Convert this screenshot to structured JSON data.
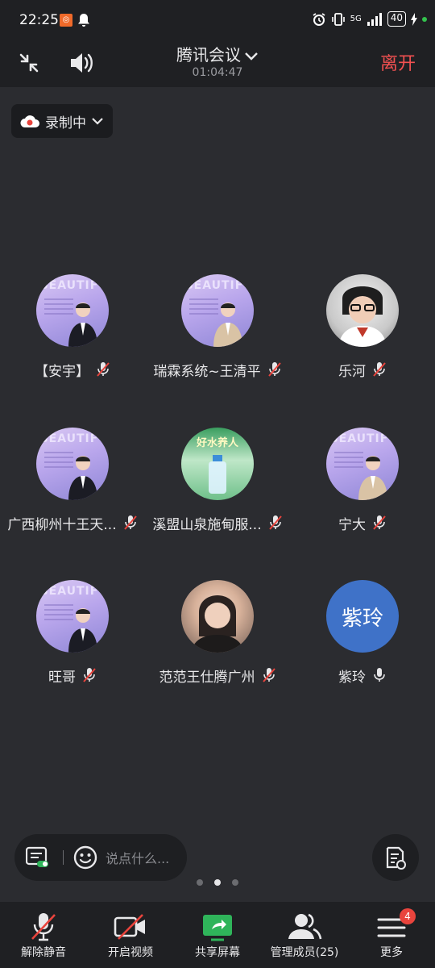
{
  "status_bar": {
    "time": "22:25",
    "network": "5G",
    "battery": "40"
  },
  "header": {
    "title": "腾讯会议",
    "timer": "01:04:47",
    "leave_label": "离开"
  },
  "recording": {
    "label": "录制中"
  },
  "participants": [
    {
      "name": "【安宇】",
      "muted": true,
      "avatar": "poster-man"
    },
    {
      "name": "瑞霖系统~王清平",
      "muted": true,
      "avatar": "poster-woman"
    },
    {
      "name": "乐河",
      "muted": true,
      "avatar": "photo-woman-glasses"
    },
    {
      "name": "广西柳州十王天...",
      "muted": true,
      "avatar": "poster-man"
    },
    {
      "name": "溪盟山泉施甸服...",
      "muted": true,
      "avatar": "water-ad"
    },
    {
      "name": "宁大",
      "muted": true,
      "avatar": "poster-woman"
    },
    {
      "name": "旺哥",
      "muted": true,
      "avatar": "poster-man"
    },
    {
      "name": "范范王仕腾广州",
      "muted": true,
      "avatar": "photo-woman"
    },
    {
      "name": "紫玲",
      "muted": false,
      "avatar": "text",
      "avatar_text": "紫玲"
    }
  ],
  "avatar_texts": {
    "poster": "BEAUTIFY",
    "water": "好水养人"
  },
  "chat": {
    "placeholder": "说点什么..."
  },
  "toolbar": {
    "unmute": "解除静音",
    "video": "开启视频",
    "share": "共享屏幕",
    "members": "管理成员(25)",
    "more": "更多",
    "more_badge": "4"
  },
  "colors": {
    "accent_red": "#f25151",
    "share_green": "#2fb45a",
    "avatar_blue": "#3f72c8"
  }
}
